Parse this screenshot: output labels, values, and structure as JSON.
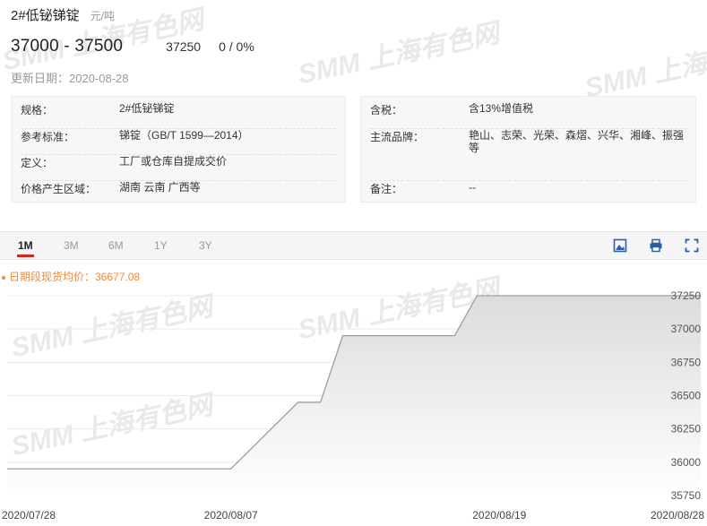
{
  "header": {
    "product_name": "2#低铋锑锭",
    "unit": "元/吨",
    "price_range": "37000 - 37500",
    "avg_price": "37250",
    "change": "0 / 0%",
    "update_label": "更新日期：",
    "update_date": "2020-08-28"
  },
  "info_left": [
    {
      "key": "规格：",
      "value": "2#低铋锑锭"
    },
    {
      "key": "参考标准：",
      "value": "锑锭（GB/T 1599—2014）"
    },
    {
      "key": "定义：",
      "value": "工厂或仓库自提成交价"
    },
    {
      "key": "价格产生区域：",
      "value": "湖南 云南 广西等"
    }
  ],
  "info_right": [
    {
      "key": "含税：",
      "value": "含13%增值税"
    },
    {
      "key": "主流品牌：",
      "value": "艳山、志荣、光荣、森熠、兴华、湘峰、振强等"
    },
    {
      "key": "备注：",
      "value": "--"
    }
  ],
  "tabs": [
    "1M",
    "3M",
    "6M",
    "1Y",
    "3Y"
  ],
  "active_tab": "1M",
  "toolbar_icons": [
    "image-save-icon",
    "print-icon",
    "fullscreen-icon"
  ],
  "watermark_text": "SMM 上海有色网",
  "legend_text": "日期段现货均价：36677.08",
  "colors": {
    "accent_red": "#d9261c",
    "legend_orange": "#ee8a3a",
    "line": "#9e9e9e",
    "area_top": "#dcdcdc",
    "area_bottom": "#ffffff"
  },
  "chart_data": {
    "type": "area",
    "y_ticks": [
      37250,
      37000,
      36750,
      36500,
      36250,
      36000,
      35750
    ],
    "x_tick_labels": [
      "2020/07/28",
      "2020/08/07",
      "2020/08/19",
      "2020/08/28"
    ],
    "ylim": [
      35750,
      37300
    ],
    "grid": true,
    "series": [
      {
        "x": [
          "2020/07/28",
          "2020/07/29",
          "2020/07/30",
          "2020/07/31",
          "2020/08/03",
          "2020/08/04",
          "2020/08/05",
          "2020/08/06",
          "2020/08/07",
          "2020/08/10",
          "2020/08/11",
          "2020/08/12",
          "2020/08/13",
          "2020/08/14",
          "2020/08/17",
          "2020/08/18",
          "2020/08/19",
          "2020/08/20",
          "2020/08/21",
          "2020/08/24",
          "2020/08/25",
          "2020/08/26",
          "2020/08/27",
          "2020/08/28"
        ],
        "values": [
          35950,
          35950,
          35950,
          35950,
          35950,
          35950,
          35950,
          35950,
          35950,
          36450,
          36450,
          36950,
          36950,
          36950,
          36950,
          37250,
          37250,
          37250,
          37250,
          37250,
          37250,
          37250,
          37250,
          37250
        ]
      }
    ]
  }
}
